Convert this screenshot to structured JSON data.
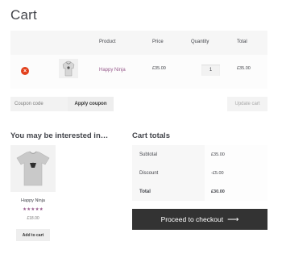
{
  "page": {
    "title": "Cart"
  },
  "cart": {
    "headers": {
      "product": "Product",
      "price": "Price",
      "quantity": "Quantity",
      "total": "Total"
    },
    "item": {
      "remove_icon": "×",
      "name": "Happy Ninja",
      "price": "£35.00",
      "quantity": "1",
      "total": "£35.00"
    }
  },
  "actions": {
    "coupon_placeholder": "Coupon code",
    "apply_label": "Apply coupon",
    "update_label": "Update cart"
  },
  "cross_sells": {
    "title": "You may be interested in…",
    "product": {
      "name": "Happy Ninja",
      "rating_stars": "★★★★★",
      "rating": 5,
      "price": "£18.00",
      "button": "Add to cart"
    }
  },
  "totals": {
    "title": "Cart totals",
    "rows": [
      {
        "label": "Subtotal",
        "value": "£35.00"
      },
      {
        "label": "Discount",
        "value": "-£5.00"
      },
      {
        "label": "Total",
        "value": "£30.00"
      }
    ],
    "checkout_label": "Proceed to checkout",
    "checkout_arrow": "⟶"
  },
  "colors": {
    "accent": "#96588a",
    "remove": "#e2401c",
    "checkout_bg": "#333333"
  }
}
